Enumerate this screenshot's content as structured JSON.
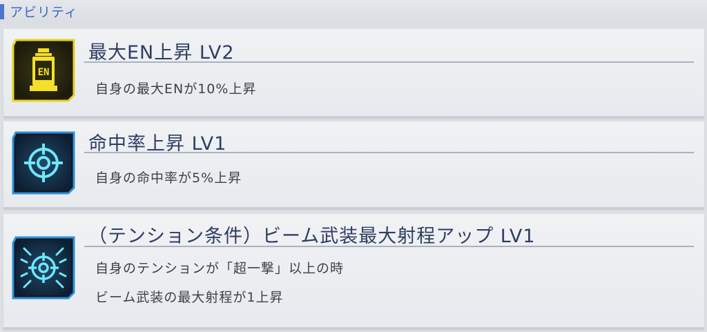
{
  "header": {
    "title": "アビリティ"
  },
  "abilities": [
    {
      "icon": "energy-canister-icon",
      "name": "最大EN上昇 LV2",
      "desc": [
        "自身の最大ENが10%上昇"
      ]
    },
    {
      "icon": "crosshair-icon",
      "name": "命中率上昇 LV1",
      "desc": [
        "自身の命中率が5%上昇"
      ]
    },
    {
      "icon": "crosshair-burst-icon",
      "name": "（テンション条件）ビーム武装最大射程アップ LV1",
      "desc": [
        "自身のテンションが「超一撃」以上の時",
        "ビーム武装の最大射程が1上昇"
      ]
    }
  ],
  "icon_text": {
    "en": "EN"
  },
  "colors": {
    "accent": "#4f73c8",
    "title_text": "#2f3d63",
    "icon_yellow": "#f4e028",
    "icon_cyan": "#5fe0ff"
  }
}
